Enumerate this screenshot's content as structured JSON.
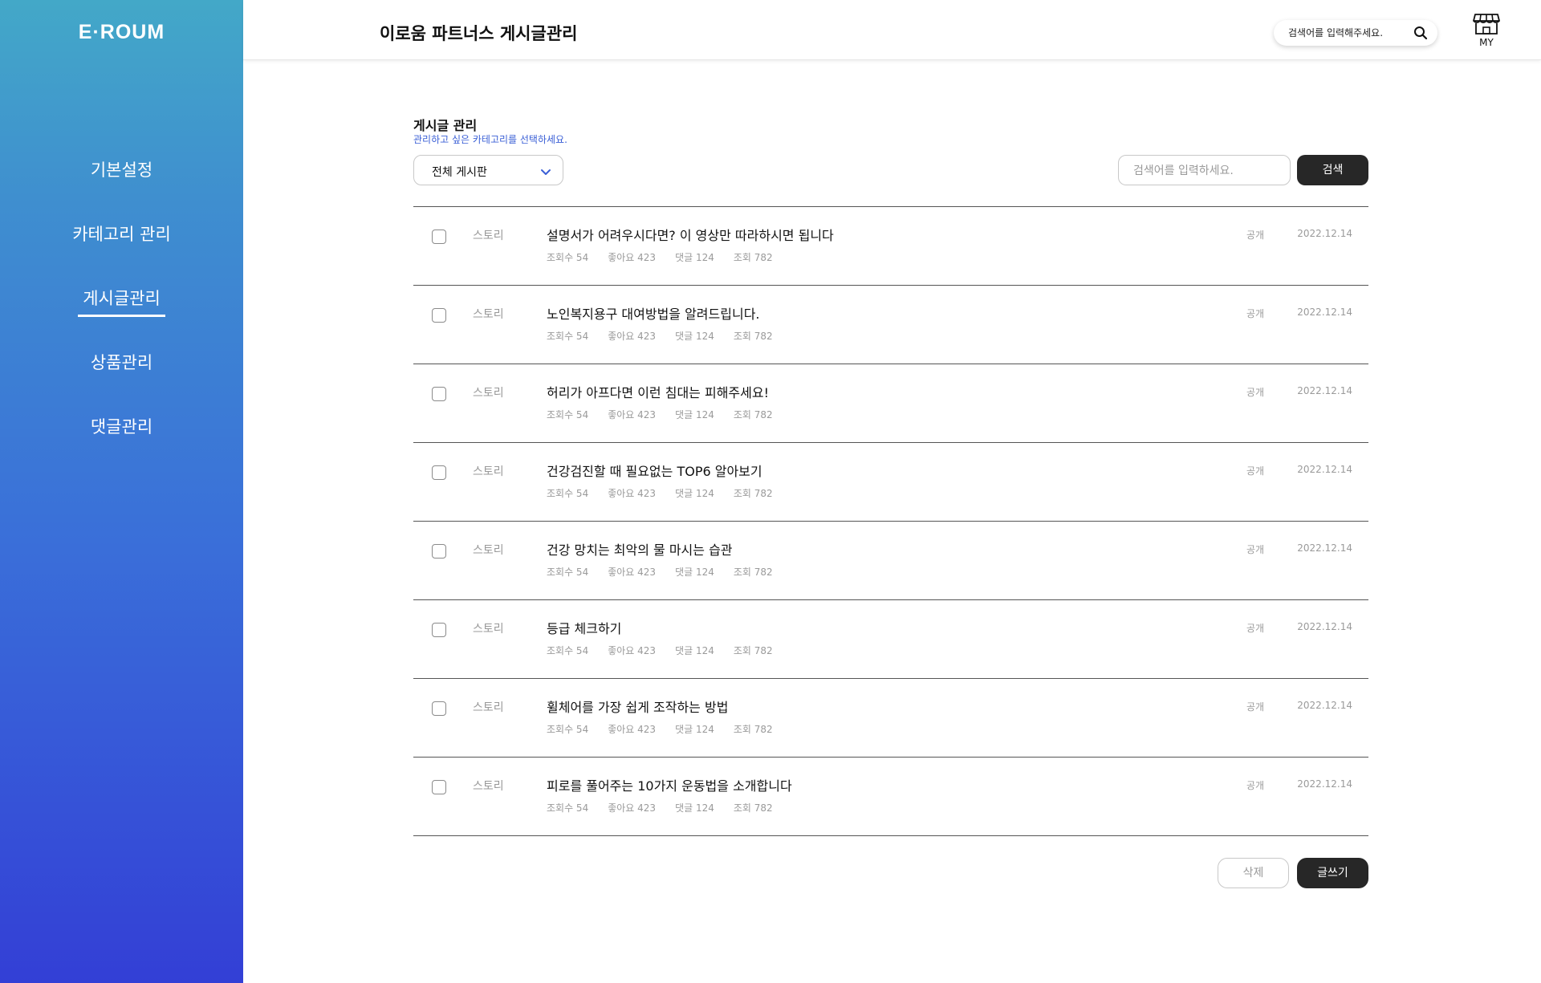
{
  "sidebar": {
    "logo": "E·ROUM",
    "items": [
      {
        "label": "기본설정",
        "active": false
      },
      {
        "label": "카테고리 관리",
        "active": false
      },
      {
        "label": "게시글관리",
        "active": true
      },
      {
        "label": "상품관리",
        "active": false
      },
      {
        "label": "댓글관리",
        "active": false
      }
    ]
  },
  "header": {
    "title": "이로움 파트너스 게시글관리",
    "search_placeholder": "검색어를 입력해주세요.",
    "search_icon": "search-icon",
    "my_icon": "store-icon",
    "my_label": "MY"
  },
  "section": {
    "title": "게시글 관리",
    "subtitle": "관리하고 싶은 카테고리를 선택하세요."
  },
  "filter": {
    "selected": "전체 게시판",
    "search_placeholder": "검색어를 입력하세요.",
    "search_button": "검색"
  },
  "posts": [
    {
      "category": "스토리",
      "title": "설명서가 어려우시다면? 이 영상만 따라하시면 됩니다",
      "views": "조회수 54",
      "likes": "좋아요 423",
      "comments": "댓글 124",
      "reads": "조회 782",
      "status": "공개",
      "date": "2022.12.14"
    },
    {
      "category": "스토리",
      "title": "노인복지용구 대여방법을 알려드립니다.",
      "views": "조회수 54",
      "likes": "좋아요 423",
      "comments": "댓글 124",
      "reads": "조회 782",
      "status": "공개",
      "date": "2022.12.14"
    },
    {
      "category": "스토리",
      "title": "허리가 아프다면 이런 침대는 피해주세요!",
      "views": "조회수 54",
      "likes": "좋아요 423",
      "comments": "댓글 124",
      "reads": "조회 782",
      "status": "공개",
      "date": "2022.12.14"
    },
    {
      "category": "스토리",
      "title": "건강검진할 때 필요없는 TOP6 알아보기",
      "views": "조회수 54",
      "likes": "좋아요 423",
      "comments": "댓글 124",
      "reads": "조회 782",
      "status": "공개",
      "date": "2022.12.14"
    },
    {
      "category": "스토리",
      "title": "건강 망치는 최악의 물 마시는 습관",
      "views": "조회수 54",
      "likes": "좋아요 423",
      "comments": "댓글 124",
      "reads": "조회 782",
      "status": "공개",
      "date": "2022.12.14"
    },
    {
      "category": "스토리",
      "title": "등급 체크하기",
      "views": "조회수 54",
      "likes": "좋아요 423",
      "comments": "댓글 124",
      "reads": "조회 782",
      "status": "공개",
      "date": "2022.12.14"
    },
    {
      "category": "스토리",
      "title": "휠체어를 가장 쉽게 조작하는 방법",
      "views": "조회수 54",
      "likes": "좋아요 423",
      "comments": "댓글 124",
      "reads": "조회 782",
      "status": "공개",
      "date": "2022.12.14"
    },
    {
      "category": "스토리",
      "title": "피로를 풀어주는 10가지 운동법을 소개합니다",
      "views": "조회수 54",
      "likes": "좋아요 423",
      "comments": "댓글 124",
      "reads": "조회 782",
      "status": "공개",
      "date": "2022.12.14"
    }
  ],
  "actions": {
    "delete": "삭제",
    "write": "글쓰기"
  },
  "colors": {
    "sidebar_top": "#43a8c8",
    "sidebar_bottom": "#333fd6",
    "accent_text": "#3a5fd6",
    "dark_button": "#272727"
  }
}
